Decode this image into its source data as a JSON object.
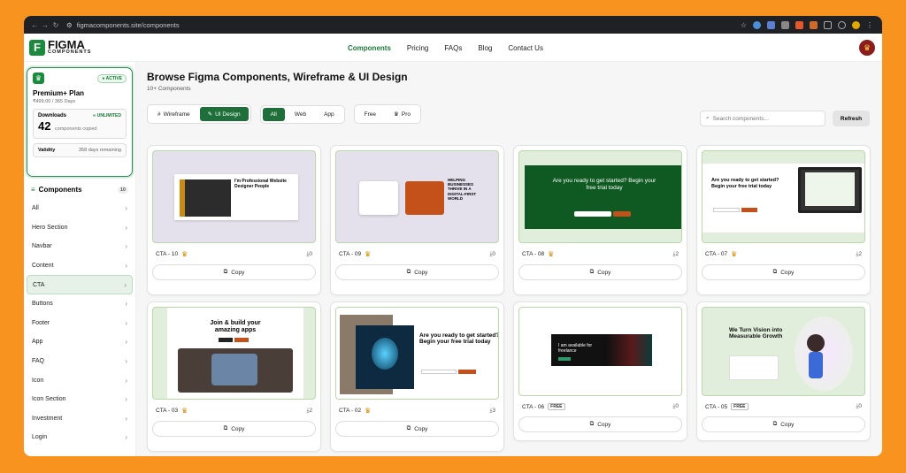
{
  "browser": {
    "url": "figmacomponents.site/components"
  },
  "brand": {
    "logo_letter": "F",
    "name": "FIGMA",
    "tagline": "COMPONENTS"
  },
  "nav": {
    "items": [
      "Components",
      "Pricing",
      "FAQs",
      "Blog",
      "Contact Us"
    ],
    "active": "Components"
  },
  "plan": {
    "status": "ACTIVE",
    "name": "Premium+ Plan",
    "price": "₹499.00 / 365 Days",
    "downloads_label": "Downloads",
    "downloads_badge": "∞ UNLIMITED",
    "downloads_count": "42",
    "downloads_sub": "components copied",
    "validity_label": "Validity",
    "validity_value": "358 days remaining"
  },
  "sidebar": {
    "components_label": "Components",
    "components_count": "10",
    "items": [
      "All",
      "Hero Section",
      "Navbar",
      "Content",
      "CTA",
      "Buttons",
      "Footer",
      "App",
      "FAQ",
      "Icon",
      "Icon Section",
      "Investment",
      "Login"
    ],
    "active": "CTA"
  },
  "main": {
    "title": "Browse Figma Components, Wireframe & UI Design",
    "subtitle": "10+ Components",
    "search_placeholder": "Search components...",
    "refresh_label": "Refresh"
  },
  "filters": {
    "type": [
      "Wireframe",
      "UI Design"
    ],
    "type_active": "UI Design",
    "platform": [
      "All",
      "Web",
      "App"
    ],
    "platform_active": "All",
    "pricing": [
      "Free",
      "Pro"
    ]
  },
  "cards": [
    {
      "name": "CTA - 10",
      "tier": "pro",
      "downloads": "0",
      "copy": "Copy",
      "preview": "I'm Professional Website Designer People"
    },
    {
      "name": "CTA - 09",
      "tier": "pro",
      "downloads": "0",
      "copy": "Copy",
      "preview": "HELPING BUSINESSES THRIVE IN A DIGITAL-FIRST WORLD"
    },
    {
      "name": "CTA - 08",
      "tier": "pro",
      "downloads": "2",
      "copy": "Copy",
      "preview": "Are you ready to get started? Begin your free trial today"
    },
    {
      "name": "CTA - 07",
      "tier": "pro",
      "downloads": "2",
      "copy": "Copy",
      "preview": "Are you ready to get started? Begin your free trial today"
    },
    {
      "name": "CTA - 03",
      "tier": "pro",
      "downloads": "2",
      "copy": "Copy",
      "preview": "Join & build your amazing apps"
    },
    {
      "name": "CTA - 02",
      "tier": "pro",
      "downloads": "3",
      "copy": "Copy",
      "preview": "Are you ready to get started? Begin your free trial today"
    },
    {
      "name": "CTA - 06",
      "tier": "free",
      "tier_label": "FREE",
      "downloads": "0",
      "copy": "Copy",
      "preview": "I am available for freelance"
    },
    {
      "name": "CTA - 05",
      "tier": "free",
      "tier_label": "FREE",
      "downloads": "0",
      "copy": "Copy",
      "preview": "We Turn Vision into Measurable Growth"
    }
  ]
}
